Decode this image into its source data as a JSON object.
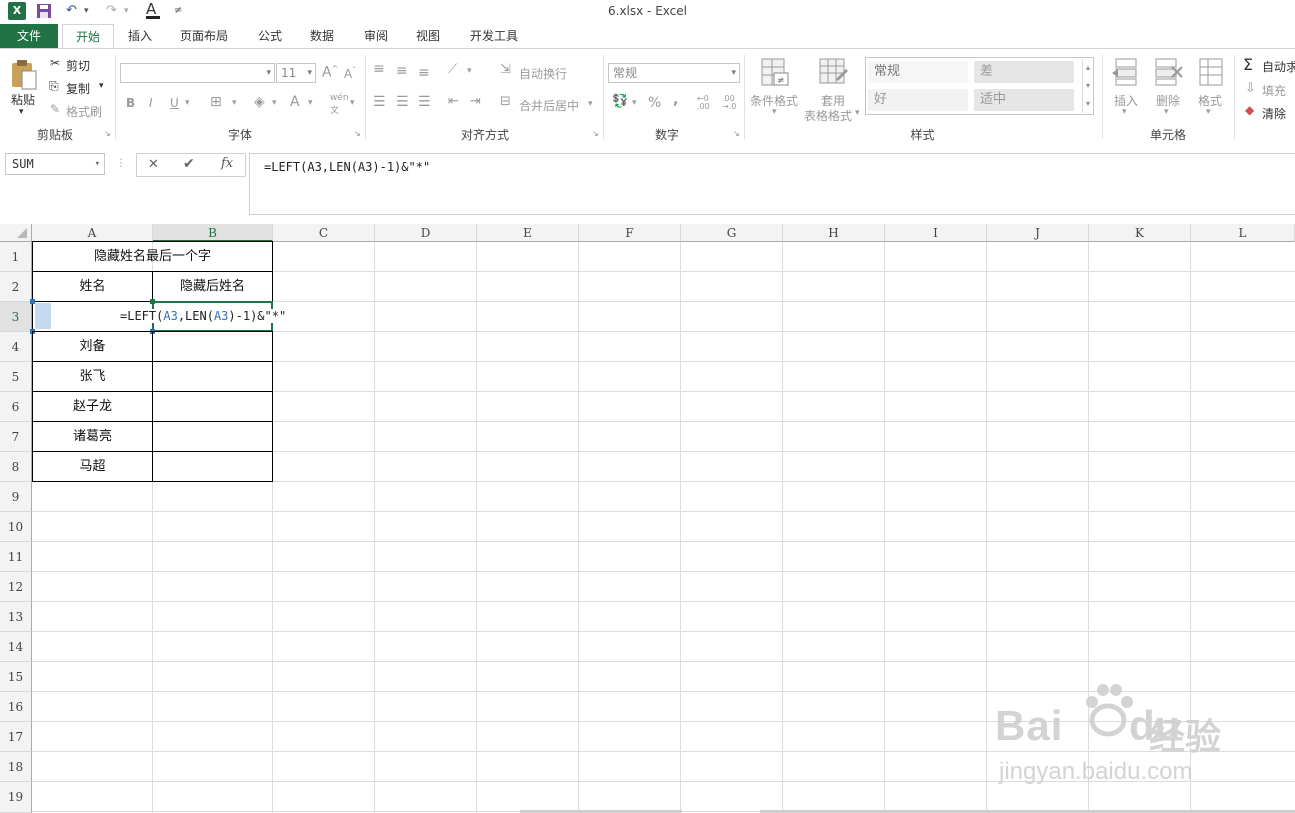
{
  "window": {
    "title": "6.xlsx - Excel"
  },
  "tabs": [
    "文件",
    "开始",
    "插入",
    "页面布局",
    "公式",
    "数据",
    "审阅",
    "视图",
    "开发工具"
  ],
  "ribbon": {
    "clipboard": {
      "paste": "粘贴",
      "cut": "剪切",
      "copy": "复制",
      "format_painter": "格式刷",
      "label": "剪贴板"
    },
    "font": {
      "size": "11",
      "bold": "B",
      "italic": "I",
      "underline": "U",
      "label": "字体",
      "font_color_letter": "A",
      "phonetic": "wén"
    },
    "alignment": {
      "wrap": "自动换行",
      "merge": "合并后居中",
      "label": "对齐方式"
    },
    "number": {
      "format": "常规",
      "percent": "%",
      "comma": ",",
      "inc_dec": ".00",
      "label": "数字"
    },
    "styles": {
      "conditional": "条件格式",
      "table1": "套用",
      "table2": "表格格式",
      "normal": "常规",
      "bad": "差",
      "good": "好",
      "neutral": "适中",
      "label": "样式"
    },
    "cells": {
      "insert": "插入",
      "delete": "删除",
      "format": "格式",
      "label": "单元格"
    },
    "editing": {
      "autosum": "自动求",
      "fill": "填充",
      "clear": "清除"
    },
    "colors": {
      "accent": "#217346",
      "bad_bg": "#e6e6e6",
      "good_bg": "#e6e6e6"
    }
  },
  "formula_bar": {
    "name_box": "SUM",
    "cancel": "✕",
    "enter": "✔",
    "fx": "fx",
    "formula": "=LEFT(A3,LEN(A3)-1)&\"*\""
  },
  "sheet": {
    "columns": [
      "A",
      "B",
      "C",
      "D",
      "E",
      "F",
      "G",
      "H",
      "I",
      "J",
      "K",
      "L"
    ],
    "rows": [
      "1",
      "2",
      "3",
      "4",
      "5",
      "6",
      "7",
      "8",
      "9",
      "10",
      "11",
      "12",
      "13",
      "14",
      "15",
      "16",
      "17",
      "18",
      "19"
    ],
    "title": "隐藏姓名最后一个字",
    "header_a": "姓名",
    "header_b": "隐藏后姓名",
    "editing_formula": {
      "prefix": "=LEFT(",
      "ref1": "A3",
      "mid": ",LEN(",
      "ref2": "A3",
      "suffix": ")-1)&\"*\""
    },
    "names": [
      "刘备",
      "张飞",
      "赵子龙",
      "诸葛亮",
      "马超"
    ]
  },
  "watermark": {
    "brand": "Bai",
    "brand_tail": "du",
    "brand_cn": "经验",
    "url": "jingyan.baidu.com"
  }
}
